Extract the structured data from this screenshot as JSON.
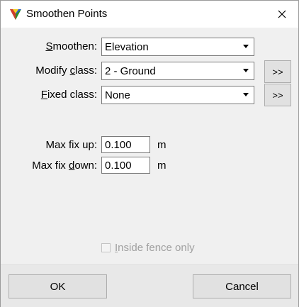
{
  "window": {
    "title": "Smoothen Points"
  },
  "form": {
    "smoothen": {
      "label_pre": "",
      "label_u": "S",
      "label_post": "moothen:",
      "value": "Elevation"
    },
    "modify_class": {
      "label_pre": "Modify ",
      "label_u": "c",
      "label_post": "lass:",
      "value": "2 - Ground",
      "more_label": ">>"
    },
    "fixed_class": {
      "label_pre": "",
      "label_u": "F",
      "label_post": "ixed class:",
      "value": "None",
      "more_label": ">>"
    },
    "max_fix_up": {
      "label": "Max fix up:",
      "value": "0.100",
      "unit": "m"
    },
    "max_fix_down": {
      "label_pre": "Max fix ",
      "label_u": "d",
      "label_post": "own:",
      "value": "0.100",
      "unit": "m"
    },
    "inside_fence": {
      "label_u": "I",
      "label_post": "nside fence only",
      "checked": false,
      "enabled": false
    }
  },
  "buttons": {
    "ok": "OK",
    "cancel": "Cancel"
  }
}
